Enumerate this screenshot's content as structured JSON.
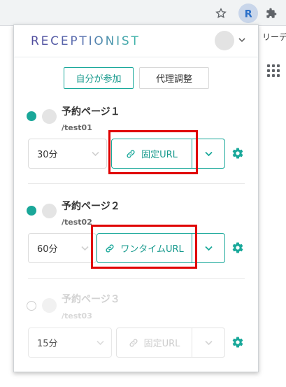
{
  "browser": {
    "star_icon": "star-icon",
    "extension_icon": "receptionist-extension-icon",
    "puzzle_icon": "puzzle-icon",
    "bg_text": "リーディ",
    "grid_icon": "apps-grid-icon"
  },
  "popup": {
    "brand": "RECEPTIONIST",
    "modes": {
      "self": "自分が参加",
      "proxy": "代理調整"
    },
    "pages": [
      {
        "title": "予約ページ１",
        "slug": "/test01",
        "duration": "30分",
        "url_button": "固定URL",
        "active": true
      },
      {
        "title": "予約ページ２",
        "slug": "/test02",
        "duration": "60分",
        "url_button": "ワンタイムURL",
        "active": true
      },
      {
        "title": "予約ページ３",
        "slug": "/test03",
        "duration": "15分",
        "url_button": "固定URL",
        "active": false
      }
    ]
  },
  "colors": {
    "accent": "#19a89a",
    "highlight": "#e00000"
  }
}
